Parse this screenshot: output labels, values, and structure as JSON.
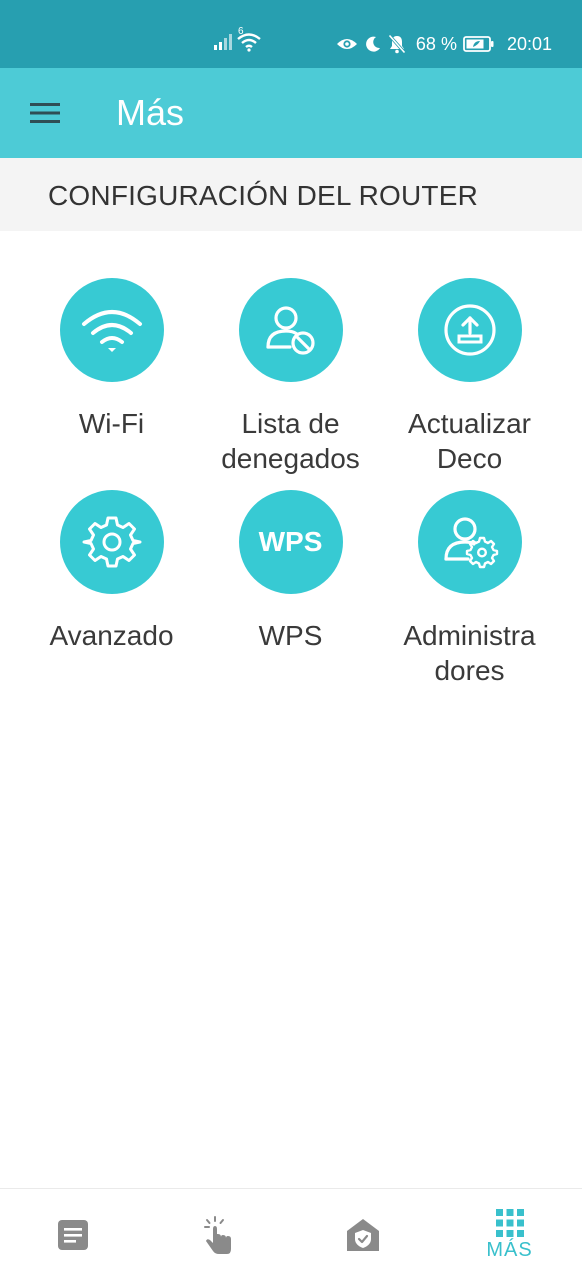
{
  "status_bar": {
    "network_badge": "6",
    "battery_percent": "68 %",
    "time": "20:01"
  },
  "app_bar": {
    "title": "Más"
  },
  "section": {
    "title": "CONFIGURACIÓN DEL ROUTER"
  },
  "tiles": [
    {
      "label": "Wi-Fi",
      "icon": "wifi-icon"
    },
    {
      "label": "Lista de denegados",
      "icon": "blocked-user-icon"
    },
    {
      "label": "Actualizar Deco",
      "icon": "upload-icon"
    },
    {
      "label": "Avanzado",
      "icon": "gear-icon"
    },
    {
      "label": "WPS",
      "icon": "wps-icon",
      "icon_text": "WPS"
    },
    {
      "label": "Administra dores",
      "icon": "admin-user-gear-icon"
    }
  ],
  "bottom_nav": {
    "items": [
      {
        "icon": "overview-icon",
        "active": false
      },
      {
        "icon": "hand-tap-icon",
        "active": false
      },
      {
        "icon": "home-shield-icon",
        "active": false
      },
      {
        "icon": "grid-icon",
        "label": "MÁS",
        "active": true
      }
    ]
  },
  "colors": {
    "status_bar": "#279fb0",
    "app_bar": "#4dcbd6",
    "accent": "#37cad3",
    "active_nav": "#39c0cc",
    "inactive_nav": "#8a8a8a"
  }
}
